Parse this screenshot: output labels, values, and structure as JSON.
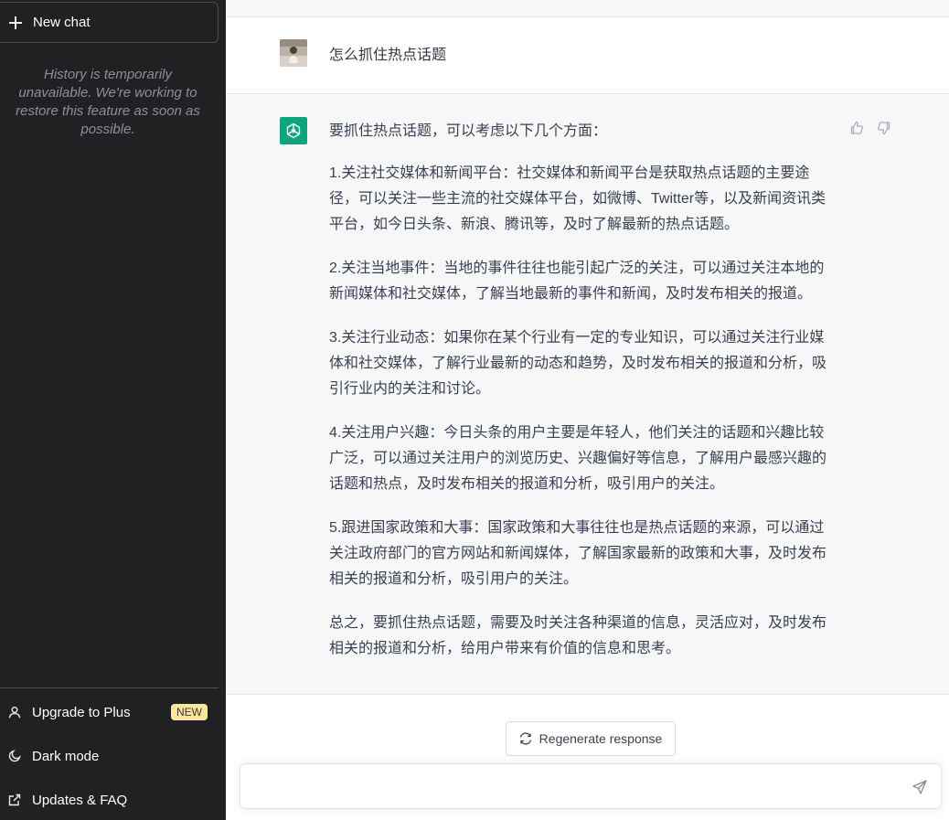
{
  "sidebar": {
    "new_chat_label": "New chat",
    "history_note": "History is temporarily unavailable. We're working to restore this feature as soon as possible.",
    "items": [
      {
        "label": "Upgrade to Plus",
        "icon": "user-icon",
        "badge": "NEW"
      },
      {
        "label": "Dark mode",
        "icon": "moon-icon"
      },
      {
        "label": "Updates & FAQ",
        "icon": "external-link-icon"
      }
    ]
  },
  "conversation": {
    "user_message": "怎么抓住热点话题",
    "assistant_paragraphs": [
      "要抓住热点话题，可以考虑以下几个方面：",
      "1.关注社交媒体和新闻平台：社交媒体和新闻平台是获取热点话题的主要途径，可以关注一些主流的社交媒体平台，如微博、Twitter等，以及新闻资讯类平台，如今日头条、新浪、腾讯等，及时了解最新的热点话题。",
      "2.关注当地事件：当地的事件往往也能引起广泛的关注，可以通过关注本地的新闻媒体和社交媒体，了解当地最新的事件和新闻，及时发布相关的报道。",
      "3.关注行业动态：如果你在某个行业有一定的专业知识，可以通过关注行业媒体和社交媒体，了解行业最新的动态和趋势，及时发布相关的报道和分析，吸引行业内的关注和讨论。",
      "4.关注用户兴趣：今日头条的用户主要是年轻人，他们关注的话题和兴趣比较广泛，可以通过关注用户的浏览历史、兴趣偏好等信息，了解用户最感兴趣的话题和热点，及时发布相关的报道和分析，吸引用户的关注。",
      "5.跟进国家政策和大事：国家政策和大事往往也是热点话题的来源，可以通过关注政府部门的官方网站和新闻媒体，了解国家最新的政策和大事，及时发布相关的报道和分析，吸引用户的关注。",
      "总之，要抓住热点话题，需要及时关注各种渠道的信息，灵活应对，及时发布相关的报道和分析，给用户带来有价值的信息和思考。"
    ]
  },
  "composer": {
    "regenerate_label": "Regenerate response",
    "input_value": "",
    "input_placeholder": ""
  },
  "colors": {
    "sidebar_bg": "#202123",
    "accent_green": "#10a37f",
    "badge_bg": "#fae69e"
  }
}
